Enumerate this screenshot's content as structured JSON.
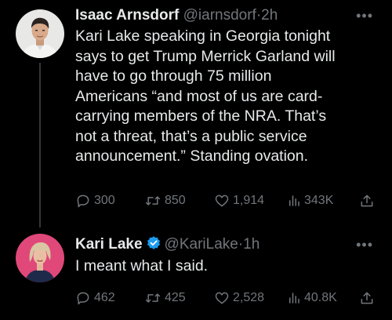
{
  "tweets": [
    {
      "author": {
        "display_name": "Isaac Arnsdorf",
        "handle": "@iarnsdorf",
        "separator": "·",
        "time": "2h",
        "verified": false,
        "avatar": "person-avatar-man"
      },
      "text_lines": [
        "Kari Lake speaking in Georgia tonight",
        "says to get Trump Merrick Garland will",
        "have to go through 75 million",
        "Americans “and most of us are card-",
        "carrying members of the NRA. That’s",
        "not a threat, that’s a public service",
        "announcement.” Standing ovation."
      ],
      "stats": {
        "replies": "300",
        "retweets": "850",
        "likes": "1,914",
        "views": "343K"
      }
    },
    {
      "author": {
        "display_name": "Kari Lake",
        "handle": "@KariLake",
        "separator": "·",
        "time": "1h",
        "verified": true,
        "avatar": "person-avatar-woman"
      },
      "text_lines": [
        "I meant what I said."
      ],
      "stats": {
        "replies": "462",
        "retweets": "425",
        "likes": "2,528",
        "views": "40.8K"
      }
    }
  ],
  "icons": {
    "more": "more-icon",
    "reply": "reply-icon",
    "retweet": "retweet-icon",
    "like": "like-icon",
    "views": "views-icon",
    "share": "share-icon",
    "verified": "verified-badge-icon"
  },
  "more_glyph": "•••",
  "colors": {
    "background": "#000000",
    "text": "#e7e9ea",
    "secondary": "#71767b",
    "verified": "#1d9bf0",
    "thread_line": "#333639"
  }
}
